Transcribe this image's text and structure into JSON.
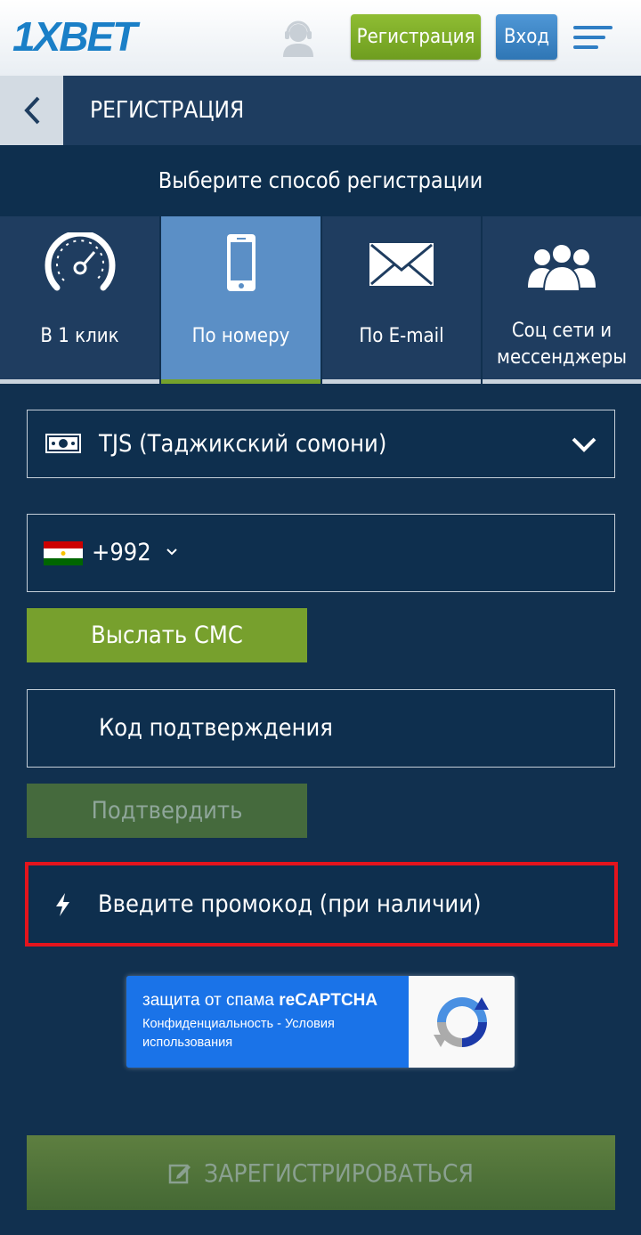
{
  "header": {
    "logo": "1XBET",
    "register_label": "Регистрация",
    "login_label": "Вход"
  },
  "titlebar": {
    "title": "РЕГИСТРАЦИЯ"
  },
  "subtitle": "Выберите способ регистрации",
  "tabs": [
    {
      "label": "В 1 клик",
      "icon": "speedometer-icon",
      "active": false
    },
    {
      "label": "По номеру",
      "icon": "mobile-phone-icon",
      "active": true
    },
    {
      "label": "По E-mail",
      "icon": "envelope-icon",
      "active": false
    },
    {
      "label_line1": "Соц сети и",
      "label_line2": "мессенджеры",
      "icon": "users-group-icon",
      "active": false
    }
  ],
  "currency": {
    "value": "TJS (Таджикский сомони)",
    "icon": "money-bill-icon"
  },
  "phone": {
    "country_code": "+992",
    "flag": "tajikistan-flag"
  },
  "send_sms_label": "Выслать СМС",
  "confirmation_code_placeholder": "Код подтверждения",
  "confirm_label": "Подтвердить",
  "promo_placeholder": "Введите промокод (при наличии)",
  "recaptcha": {
    "title_prefix": "защита от спама ",
    "title_brand": "reCAPTCHA",
    "links": "Конфиденциальность - Условия использования"
  },
  "register_submit_label": "ЗАРЕГИСТРИРОВАТЬСЯ",
  "colors": {
    "background": "#11304f",
    "tab_active": "#5b8fc6",
    "green_button": "#77a02d",
    "promo_highlight": "#e4141d"
  }
}
